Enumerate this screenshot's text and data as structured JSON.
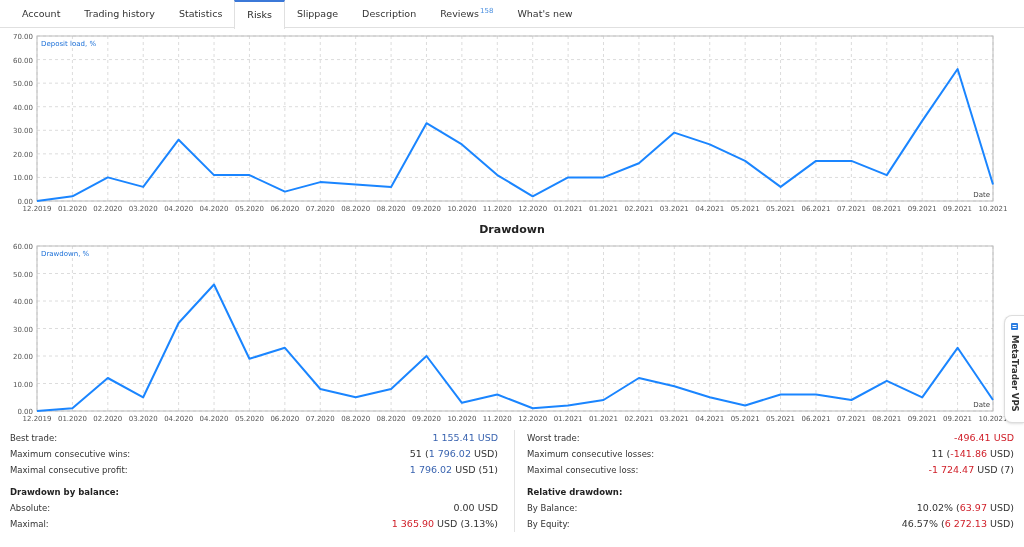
{
  "tabs": [
    {
      "label": "Account",
      "selected": false
    },
    {
      "label": "Trading history",
      "selected": false
    },
    {
      "label": "Statistics",
      "selected": false
    },
    {
      "label": "Risks",
      "selected": true
    },
    {
      "label": "Slippage",
      "selected": false
    },
    {
      "label": "Description",
      "selected": false
    },
    {
      "label": "Reviews",
      "selected": false,
      "badge": "158"
    },
    {
      "label": "What's new",
      "selected": false
    }
  ],
  "charts": [
    {
      "chart_data": {
        "type": "line",
        "grid": true,
        "ylabel": "Deposit load, %",
        "xlabel": "Date",
        "ylim": [
          0,
          70
        ],
        "yticks": [
          {
            "value": 0,
            "label": "0.00"
          },
          {
            "value": 10,
            "label": "10.00"
          },
          {
            "value": 20,
            "label": "20.00"
          },
          {
            "value": 30,
            "label": "30.00"
          },
          {
            "value": 40,
            "label": "40.00"
          },
          {
            "value": 50,
            "label": "50.00"
          },
          {
            "value": 60,
            "label": "60.00"
          },
          {
            "value": 70,
            "label": "70.00"
          }
        ],
        "categories": [
          "12.2019",
          "01.2020",
          "02.2020",
          "03.2020",
          "04.2020",
          "04.2020",
          "05.2020",
          "06.2020",
          "07.2020",
          "08.2020",
          "08.2020",
          "09.2020",
          "10.2020",
          "11.2020",
          "12.2020",
          "01.2021",
          "01.2021",
          "02.2021",
          "03.2021",
          "04.2021",
          "05.2021",
          "05.2021",
          "06.2021",
          "07.2021",
          "08.2021",
          "09.2021",
          "09.2021",
          "10.2021"
        ],
        "series": [
          {
            "color": "#1a85ff",
            "values": [
              0,
              2,
              10,
              6,
              26,
              11,
              11,
              4,
              8,
              7,
              6,
              33,
              24,
              11,
              2,
              10,
              10,
              16,
              29,
              24,
              17,
              6,
              17,
              17,
              11,
              34,
              56,
              7
            ]
          }
        ]
      }
    },
    {
      "title": "Drawdown",
      "chart_data": {
        "type": "line",
        "grid": true,
        "ylabel": "Drawdown, %",
        "xlabel": "Date",
        "ylim": [
          0,
          60
        ],
        "yticks": [
          {
            "value": 0,
            "label": "0.00"
          },
          {
            "value": 10,
            "label": "10.00"
          },
          {
            "value": 20,
            "label": "20.00"
          },
          {
            "value": 30,
            "label": "30.00"
          },
          {
            "value": 40,
            "label": "40.00"
          },
          {
            "value": 50,
            "label": "50.00"
          },
          {
            "value": 60,
            "label": "60.00"
          }
        ],
        "categories": [
          "12.2019",
          "01.2020",
          "02.2020",
          "03.2020",
          "04.2020",
          "04.2020",
          "05.2020",
          "06.2020",
          "07.2020",
          "08.2020",
          "08.2020",
          "09.2020",
          "10.2020",
          "11.2020",
          "12.2020",
          "01.2021",
          "01.2021",
          "02.2021",
          "03.2021",
          "04.2021",
          "05.2021",
          "05.2021",
          "06.2021",
          "07.2021",
          "08.2021",
          "09.2021",
          "09.2021",
          "10.2021"
        ],
        "series": [
          {
            "color": "#1a85ff",
            "values": [
              0,
              1,
              12,
              5,
              32,
              46,
              19,
              23,
              8,
              5,
              8,
              20,
              3,
              6,
              1,
              2,
              4,
              12,
              9,
              5,
              2,
              6,
              6,
              4,
              11,
              5,
              23,
              4
            ]
          }
        ]
      }
    }
  ],
  "stats": {
    "columns": [
      [
        {
          "kind": "row",
          "label": "Best trade:",
          "value": [
            {
              "text": "1 155.41 USD",
              "color": "#3a64b0"
            }
          ]
        },
        {
          "kind": "row",
          "label": "Maximum consecutive wins:",
          "value": [
            {
              "text": "51 ("
            },
            {
              "text": "1 796.02",
              "color": "#3a64b0"
            },
            {
              "text": " USD)"
            }
          ]
        },
        {
          "kind": "row",
          "label": "Maximal consecutive profit:",
          "value": [
            {
              "text": "1 796.02",
              "color": "#3a64b0"
            },
            {
              "text": " USD (51)"
            }
          ]
        },
        {
          "kind": "heading",
          "label": "Drawdown by balance:"
        },
        {
          "kind": "row",
          "label": "Absolute:",
          "value": [
            {
              "text": "0.00 USD"
            }
          ]
        },
        {
          "kind": "row",
          "label": "Maximal:",
          "value": [
            {
              "text": "1 365.90",
              "color": "#d0202a"
            },
            {
              "text": " USD (3.13%)"
            }
          ]
        }
      ],
      [
        {
          "kind": "row",
          "label": "Worst trade:",
          "value": [
            {
              "text": "-496.41 USD",
              "color": "#d0202a"
            }
          ]
        },
        {
          "kind": "row",
          "label": "Maximum consecutive losses:",
          "value": [
            {
              "text": "11 ("
            },
            {
              "text": "-141.86",
              "color": "#d0202a"
            },
            {
              "text": " USD)"
            }
          ]
        },
        {
          "kind": "row",
          "label": "Maximal consecutive loss:",
          "value": [
            {
              "text": "-1 724.47",
              "color": "#d0202a"
            },
            {
              "text": " USD (7)"
            }
          ]
        },
        {
          "kind": "heading",
          "label": "Relative drawdown:"
        },
        {
          "kind": "row",
          "label": "By Balance:",
          "value": [
            {
              "text": "10.02% ("
            },
            {
              "text": "63.97",
              "color": "#d0202a"
            },
            {
              "text": " USD)"
            }
          ]
        },
        {
          "kind": "row",
          "label": "By Equity:",
          "value": [
            {
              "text": "46.57% ("
            },
            {
              "text": "6 272.13",
              "color": "#d0202a"
            },
            {
              "text": " USD)"
            }
          ]
        }
      ]
    ]
  },
  "side_tab": {
    "label": "MetaTrader VPS"
  }
}
